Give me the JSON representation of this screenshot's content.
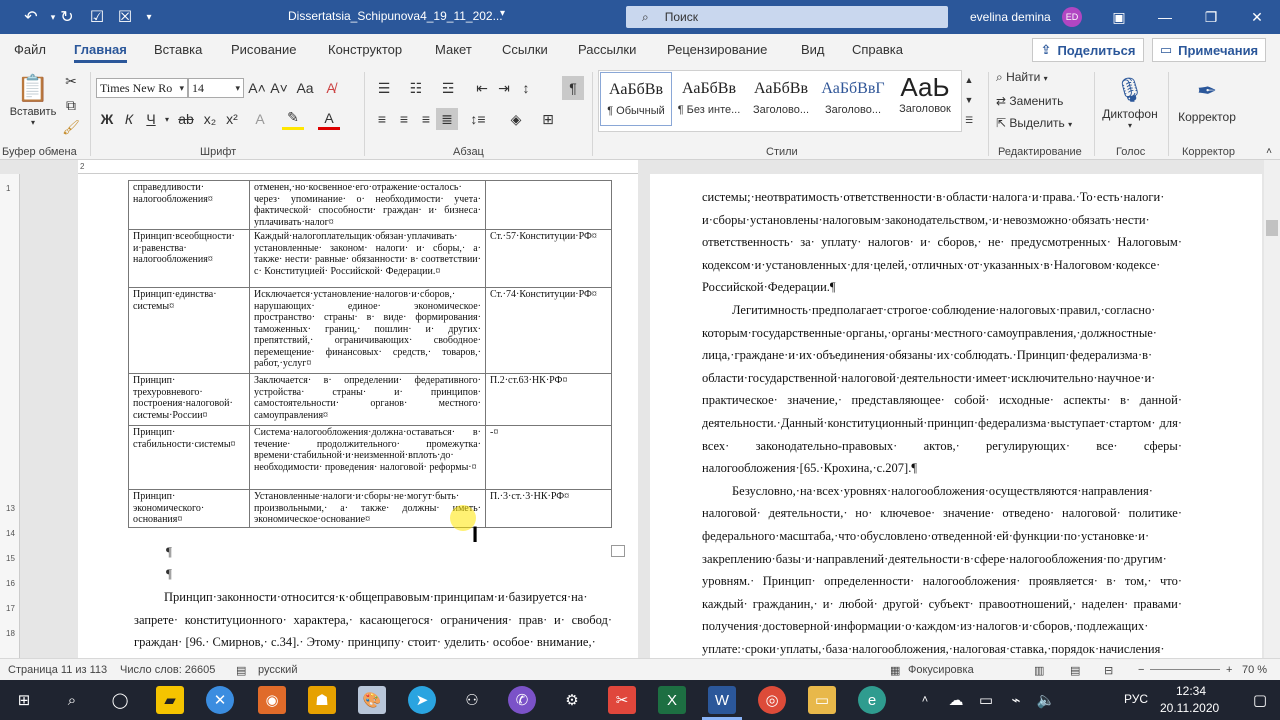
{
  "window": {
    "doc_title": "Dissertatsia_Schipunova4_19_11_202...",
    "search_placeholder": "Поиск",
    "user_name": "evelina demina",
    "user_initials": "ED"
  },
  "tabs": [
    "Файл",
    "Главная",
    "Вставка",
    "Рисование",
    "Конструктор",
    "Макет",
    "Ссылки",
    "Рассылки",
    "Рецензирование",
    "Вид",
    "Справка"
  ],
  "actions": {
    "share": "Поделиться",
    "comments": "Примечания"
  },
  "ribbon": {
    "paste": "Вставить",
    "font_name": "Times New Ro",
    "font_size": "14",
    "groups": {
      "clipboard": "Буфер обмена",
      "font": "Шрифт",
      "paragraph": "Абзац",
      "styles": "Стили",
      "editing": "Редактирование",
      "voice": "Голос",
      "editor": "Корректор"
    },
    "styles": [
      {
        "sample": "АаБбВв",
        "name": "¶ Обычный"
      },
      {
        "sample": "АаБбВв",
        "name": "¶ Без инте..."
      },
      {
        "sample": "АаБбВв",
        "name": "Заголово..."
      },
      {
        "sample": "АаБбВвГ",
        "name": "Заголово..."
      },
      {
        "sample": "АаЬ",
        "name": "Заголовок"
      }
    ],
    "find": "Найти",
    "replace": "Заменить",
    "select": "Выделить",
    "dictate": "Диктофон",
    "editor": "Корректор",
    "bold": "Ж",
    "italic": "К",
    "underline": "Ч"
  },
  "table": {
    "rows": [
      {
        "c1": "справедливости· налогообложения¤",
        "c2": "отменен,·но·косвенное·его·отражение·осталось· через· упоминание· о· необходимости· учета· фактической· способности· граждан· и· бизнеса· уплачивать·налог¤",
        "c3": ""
      },
      {
        "c1": "Принцип·всеобщности· и·равенства· налогообложения¤",
        "c2": "Каждый·налогоплательщик·обязан·уплачивать· установленные· законом· налоги· и· сборы,· а· также· нести· равные· обязанности· в· соответствии· с· Конституцией· Российской· Федерации.¤",
        "c3": "Ст.·57·Конституции·РФ¤"
      },
      {
        "c1": "Принцип·единства· системы¤",
        "c2": "Исключается·установление·налогов·и·сборов,· нарушающих· единое· экономическое· пространство· страны· в· виде· формирования· таможенных· границ,· пошлин· и· других· препятствий,· ограничивающих· свободное· перемещение· финансовых· средств,· товаров,· работ,·услуг¤",
        "c3": "Ст.·74·Конституции·РФ¤"
      },
      {
        "c1": "Принцип· трехуровневого· построения·налоговой· системы·России¤",
        "c2": "Заключается· в· определении· федеративного· устройства· страны· и· принципов· самостоятельности· органов· местного· самоуправления¤",
        "c3": "П.2·ст.63·НК·РФ¤"
      },
      {
        "c1": "Принцип· стабильности·системы¤",
        "c2": "Система·налогообложения·должна·оставаться· в· течение· продолжительного· промежутка· времени·стабильной·и·неизменной·вплоть·до· необходимости· проведения· налоговой· реформы·¤",
        "c3": "-¤"
      },
      {
        "c1": "Принцип· экономического· основания¤",
        "c2": "Установленные·налоги·и·сборы·не·могут·быть· произвольными,· а· также· должны· иметь· экономическое·основание¤",
        "c3": "П.·3·ст.·3·НК·РФ¤"
      }
    ]
  },
  "left_text": {
    "para_mark": "¶",
    "body": "Принцип·законности·относится·к·общеправовым·принципам·и·базируется·на· запрете· конституционного· характера,· касающегося· ограничения· прав· и· свобод· граждан· [96.· Смирнов,· с.34].· Этому· принципу· стоит· уделить· особое· внимание,·"
  },
  "right_text": {
    "p1": "системы;·неотвратимость·ответственности·в·области·налога·и·права.·То·есть·налоги· и·сборы·установлены·налоговым·законодательством,·и·невозможно·обязать·нести· ответственность· за· уплату· налогов· и· сборов,· не· предусмотренных· Налоговым· кодексом·и·установленных·для·целей,·отличных·от·указанных·в·Налоговом·кодексе· Российской·Федерации.¶",
    "p2": "Легитимность·предполагает·строгое·соблюдение·налоговых·правил,·согласно· которым·государственные·органы,·органы·местного·самоуправления,·должностные· лица,·граждане·и·их·объединения·обязаны·их·соблюдать.·Принцип·федерализма·в· области·государственной·налоговой·деятельности·имеет·исключительно·научное·и· практическое· значение,· представляющее· собой· исходные· аспекты· в· данной· деятельности.·Данный·конституционный·принцип·федерализма·выступает·стартом· для· всех· законодательно-правовых· актов,· регулирующих· все· сферы· налогообложения·[65.·Крохина,·с.207].¶",
    "p3": "Безусловно,·на·всех·уровнях·налогообложения·осуществляются·направления· налоговой· деятельности,· но· ключевое· значение· отведено· налоговой· политике· федерального·масштаба,·что·обусловлено·отведенной·ей·функции·по·установке·и· закреплению·базы·и·направлений·деятельности·в·сфере·налогообложения·по·другим· уровням.· Принцип· определенности· налогообложения· проявляется· в· том,· что· каждый· гражданин,· и· любой· другой· субъект· правоотношений,· наделен· правами· получения·достоверной·информации·о·каждом·из·налогов·и·сборов,·подлежащих· уплате:·сроки·уплаты,·база·налогообложения,·налоговая·ставка,·порядок·начисления·"
  },
  "status": {
    "page": "Страница 11 из 113",
    "words": "Число слов: 26605",
    "language": "русский",
    "focus": "Фокусировка",
    "zoom": "70 %"
  },
  "taskbar": {
    "lang": "РУС",
    "time": "12:34",
    "date": "20.11.2020"
  }
}
